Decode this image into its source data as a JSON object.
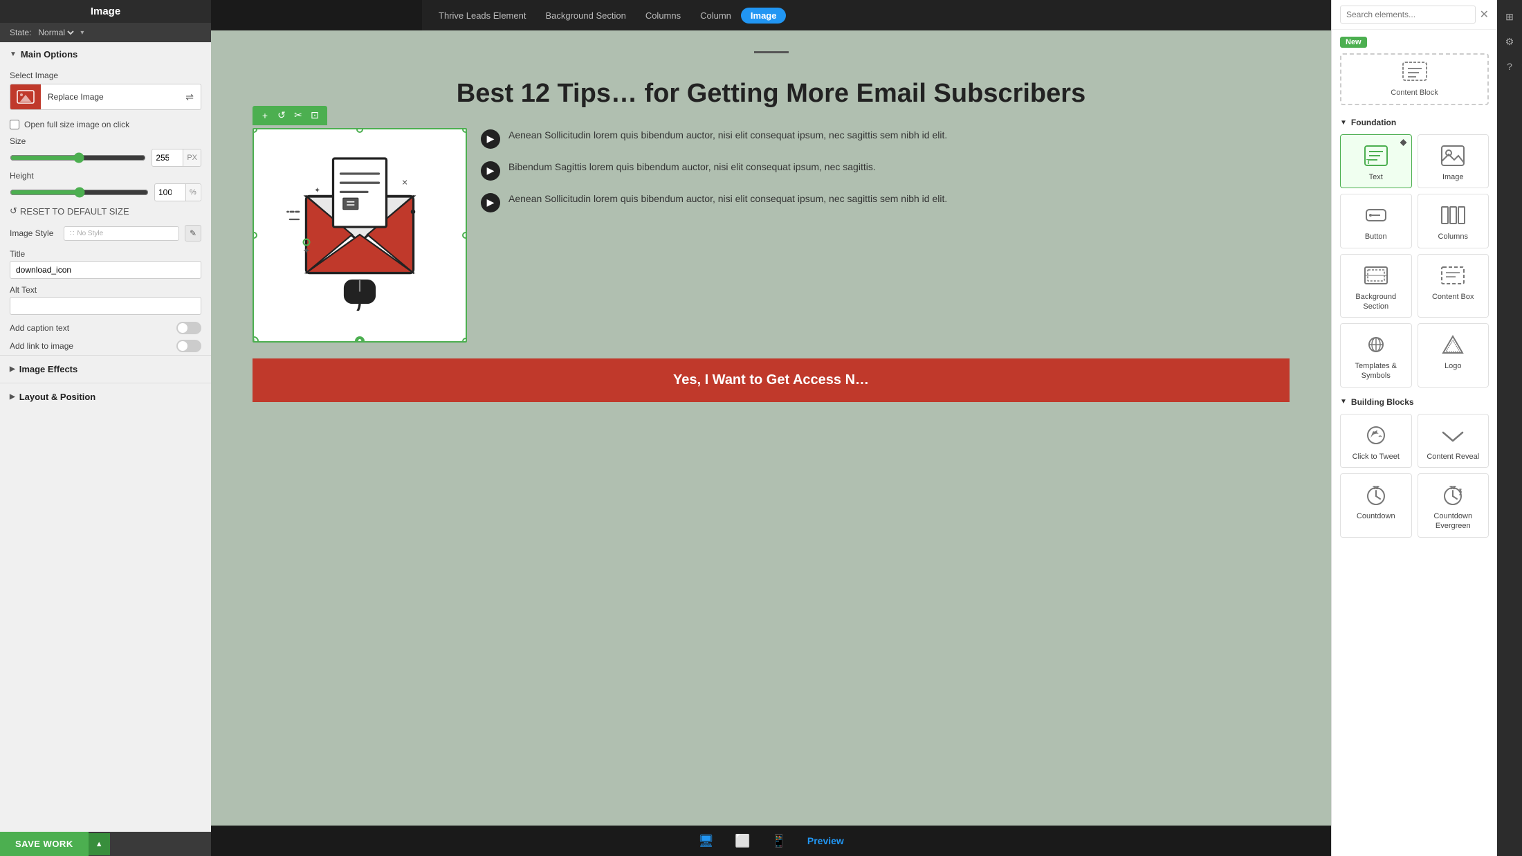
{
  "leftPanel": {
    "title": "Image",
    "stateLabel": "State:",
    "stateValue": "Normal",
    "mainOptions": {
      "header": "Main Options",
      "selectImageLabel": "Select Image",
      "replaceImageLabel": "Replace Image",
      "openFullSizeLabel": "Open full size image on click",
      "sizeLabel": "Size",
      "sizeValue": 255,
      "sizeUnit": "PX",
      "heightLabel": "Height",
      "heightValue": 100,
      "heightUnit": "%",
      "resetLabel": "RESET TO DEFAULT SIZE",
      "imageStyleLabel": "Image Style",
      "imageStyleValue": "No Style",
      "titleLabel": "Title",
      "titleValue": "download_icon",
      "altTextLabel": "Alt Text",
      "altTextValue": "",
      "addCaptionLabel": "Add caption text",
      "addLinkLabel": "Add link to image"
    },
    "imageEffects": {
      "header": "Image Effects"
    },
    "layoutPosition": {
      "header": "Layout & Position"
    },
    "saveWorkLabel": "SAVE WORK"
  },
  "breadcrumbs": [
    {
      "label": "Thrive Leads Element",
      "active": false
    },
    {
      "label": "Background Section",
      "active": false
    },
    {
      "label": "Columns",
      "active": false
    },
    {
      "label": "Column",
      "active": false
    },
    {
      "label": "Image",
      "active": true
    }
  ],
  "canvas": {
    "headline": "Best 12 Tips… for Getting More Email Subscribers",
    "bullets": [
      "Aenean Sollicitudin lorem quis bibendum auctor, nisi elit consequat ipsum, nec sagittis sem nibh id elit.",
      "Bibendum Sagittis lorem quis bibendum auctor, nisi elit consequat ipsum, nec sagittis.",
      "Aenean Sollicitudin lorem quis bibendum auctor, nisi elit consequat ipsum, nec sagittis sem nibh id elit."
    ],
    "ctaButton": "Yes, I Want to Get Access N…",
    "imageToolbar": [
      "+",
      "↺",
      "✂",
      "⊡"
    ],
    "devices": [
      "desktop",
      "tablet",
      "mobile"
    ],
    "previewLabel": "Preview"
  },
  "rightPanel": {
    "searchPlaceholder": "Search elements...",
    "newBadgeLabel": "New",
    "contentBlockLabel": "Content Block",
    "sections": [
      {
        "label": "Foundation",
        "items": [
          {
            "icon": "text",
            "label": "Text",
            "active": true
          },
          {
            "icon": "image",
            "label": "Image",
            "active": false
          },
          {
            "icon": "button",
            "label": "Button",
            "active": false
          },
          {
            "icon": "columns",
            "label": "Columns",
            "active": false
          },
          {
            "icon": "bg-section",
            "label": "Background Section",
            "active": false
          },
          {
            "icon": "content-box",
            "label": "Content Box",
            "active": false
          },
          {
            "icon": "templates-symbols",
            "label": "Templates & Symbols",
            "active": false
          },
          {
            "icon": "logo",
            "label": "Logo",
            "active": false
          }
        ]
      },
      {
        "label": "Building Blocks",
        "items": [
          {
            "icon": "click-to-tweet",
            "label": "Click to Tweet",
            "active": false
          },
          {
            "icon": "content-reveal",
            "label": "Content Reveal",
            "active": false
          },
          {
            "icon": "countdown",
            "label": "Countdown",
            "active": false
          },
          {
            "icon": "countdown-evergreen",
            "label": "Countdown Evergreen",
            "active": false
          }
        ]
      }
    ]
  }
}
